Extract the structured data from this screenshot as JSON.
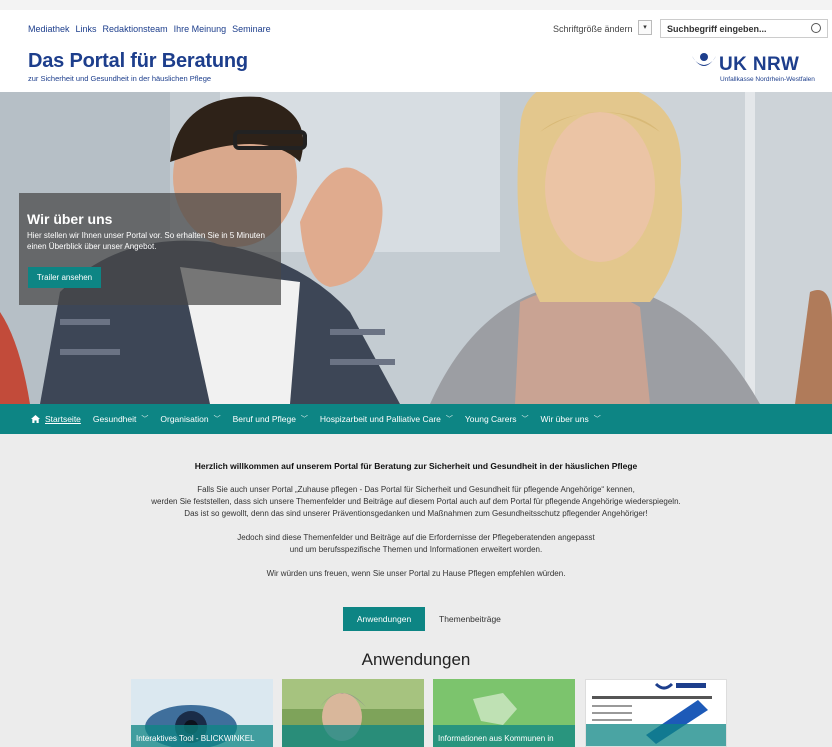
{
  "topnav": [
    "Mediathek",
    "Links",
    "Redaktionsteam",
    "Ihre Meinung",
    "Seminare"
  ],
  "header": {
    "fontsize_label": "Schriftgröße ändern",
    "search_placeholder": "Suchbegriff eingeben...",
    "title": "Das Portal für Beratung",
    "subtitle": "zur Sicherheit und Gesundheit in der häuslichen Pflege",
    "logo_name": "UK NRW",
    "logo_sub": "Unfallkasse Nordrhein-Westfalen"
  },
  "hero": {
    "title": "Wir über uns",
    "text": "Hier stellen wir Ihnen unser Portal vor. So erhalten Sie in 5 Minuten einen Überblick über unser Angebot.",
    "button": "Trailer ansehen"
  },
  "mainnav": [
    {
      "label": "Startseite",
      "icon": "home-icon"
    },
    {
      "label": "Gesundheit"
    },
    {
      "label": "Organisation"
    },
    {
      "label": "Beruf und Pflege"
    },
    {
      "label": "Hospizarbeit und Palliative Care"
    },
    {
      "label": "Young Carers"
    },
    {
      "label": "Wir über uns"
    }
  ],
  "welcome": {
    "heading": "Herzlich willkommen auf unserem Portal für Beratung zur Sicherheit und Gesundheit in der häuslichen Pflege",
    "p1_l1": "Falls Sie auch unser Portal „Zuhause pflegen - Das Portal für Sicherheit und Gesundheit für pflegende Angehörige“ kennen,",
    "p1_l2": "werden Sie feststellen, dass sich unsere Themenfelder und Beiträge auf diesem Portal auch auf dem Portal für pflegende Angehörige wiederspiegeln.",
    "p1_l3": "Das ist so gewollt, denn das sind unserer Präventionsgedanken und Maßnahmen zum Gesundheitsschutz pflegender Angehöriger!",
    "p2_l1": "Jedoch sind diese Themenfelder und Beiträge auf die Erfordernisse der Pflegeberatenden angepasst",
    "p2_l2": "und um berufsspezifische Themen und Informationen erweitert worden.",
    "p3": "Wir würden uns freuen, wenn Sie unser Portal zu Hause Pflegen empfehlen würden."
  },
  "tabs": {
    "active": "Anwendungen",
    "other": "Themenbeiträge"
  },
  "section_title": "Anwendungen",
  "cards": [
    {
      "caption": "Interaktives Tool - BLICKWINKEL"
    },
    {
      "caption": ""
    },
    {
      "caption": "Informationen aus Kommunen in"
    },
    {
      "caption": ""
    }
  ],
  "colors": {
    "brand": "#1d3e8c",
    "accent": "#0d8584",
    "background": "#ececec"
  }
}
